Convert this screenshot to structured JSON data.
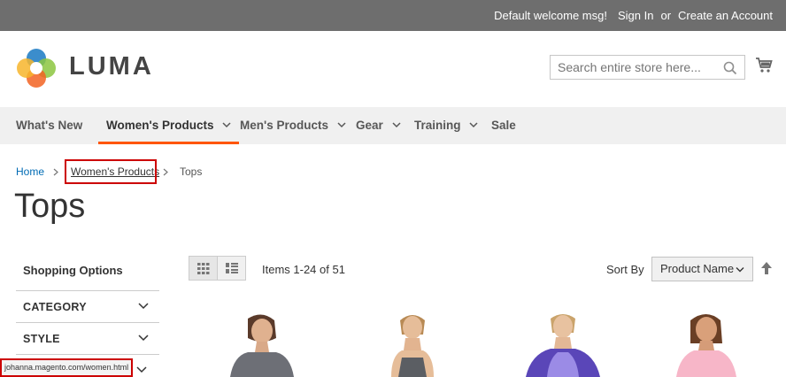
{
  "header_bar": {
    "welcome": "Default welcome msg!",
    "sign_in": "Sign In",
    "or": "or",
    "create_account": "Create an Account"
  },
  "logo": {
    "text": "LUMA"
  },
  "search": {
    "placeholder": "Search entire store here..."
  },
  "nav": [
    {
      "label": "What's New",
      "dropdown": false
    },
    {
      "label": "Women's Products",
      "dropdown": true,
      "active": true
    },
    {
      "label": "Men's Products",
      "dropdown": true
    },
    {
      "label": "Gear",
      "dropdown": true
    },
    {
      "label": "Training",
      "dropdown": true
    },
    {
      "label": "Sale",
      "dropdown": false
    }
  ],
  "breadcrumb": {
    "home": "Home",
    "parent": "Women's Products",
    "current": "Tops"
  },
  "page_title": "Tops",
  "sidebar": {
    "title": "Shopping Options",
    "filters": [
      "CATEGORY",
      "STYLE"
    ]
  },
  "toolbar": {
    "items_count": "Items 1-24 of 51",
    "sort_label": "Sort By",
    "sort_value": "Product Name"
  },
  "status_url": "johanna.magento.com/women.html",
  "colors": {
    "accent": "#ff5501",
    "link": "#006bb4",
    "topbar": "#6e6e6e",
    "nav_bg": "#f0f0f0",
    "highlight": "#cc0000"
  }
}
